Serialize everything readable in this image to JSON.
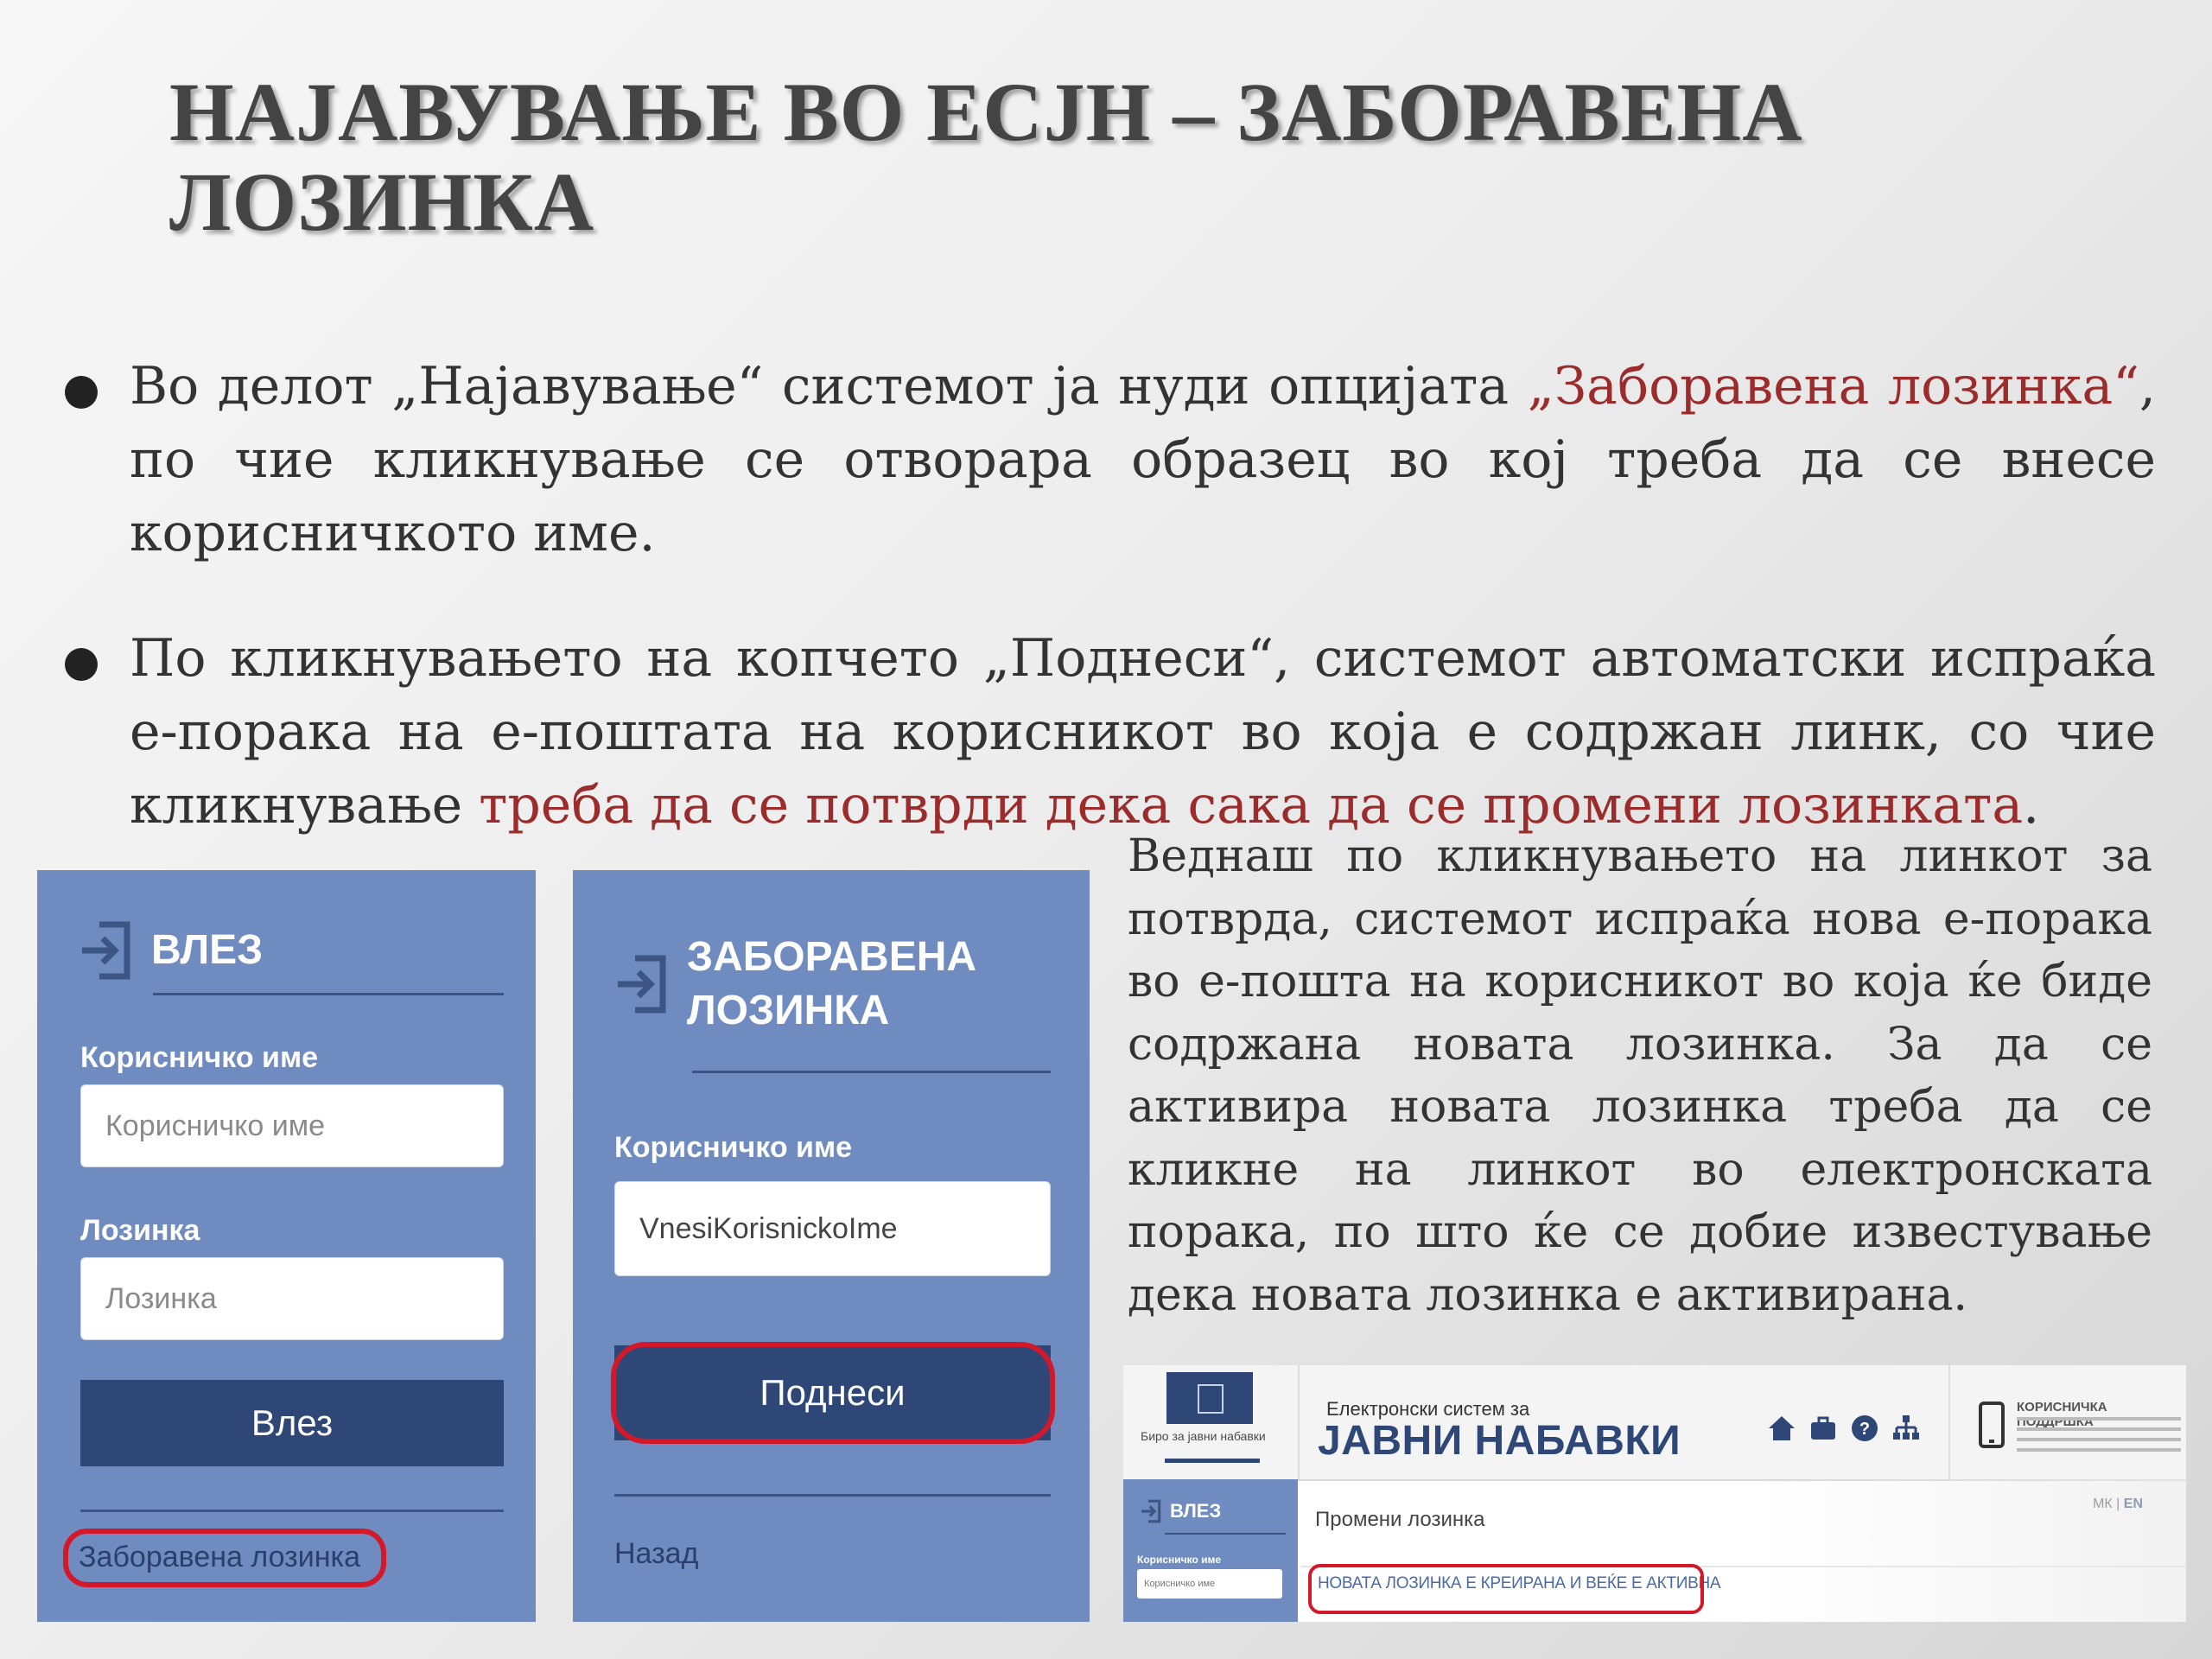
{
  "slide": {
    "title": "НАЈАВУВАЊЕ ВО ЕСЈН – ЗАБОРАВЕНА ЛОЗИНКА",
    "bullets": [
      {
        "part1": "Во делот „Најавување“ системот ја нуди опцијата ",
        "highlight": "„Заборавена лозинка“",
        "part2": ", по чие кликнување се отворара образец во кој треба да се внесе корисничкото име."
      },
      {
        "part1": "По кликнувањето на копчето „Поднеси“, системот автоматски испраќа е-порака на е-поштата на корисникот во која е содржан линк, со чие кликнување ",
        "highlight": "треба да се потврди дека сака да се промени лозинката",
        "part2": "."
      }
    ],
    "side_text": "Веднаш по кликнувањето на линкот за потврда, системот испраќа нова е-порака во е-пошта на корисникот во која ќе биде содржана новата лозинка. За да се активира новата лозинка треба да се кликне на линкот во електронската порака, по што ќе се добие известување дека новата лозинка е активирана.",
    "highlight_color": "#9c2b2b"
  },
  "login_panel": {
    "title": "ВЛЕЗ",
    "username_label": "Корисничко име",
    "username_placeholder": "Корисничко име",
    "password_label": "Лозинка",
    "password_placeholder": "Лозинка",
    "submit_label": "Влез",
    "forgot_link": "Заборавена лозинка"
  },
  "forgot_panel": {
    "title_line1": "ЗАБОРАВЕНА",
    "title_line2": "ЛОЗИНКА",
    "username_label": "Корисничко име",
    "username_value": "VnesiKorisnickoIme",
    "submit_label": "Поднеси",
    "back_link": "Назад"
  },
  "portal": {
    "subtitle": "Електронски систем за",
    "title": "ЈАВНИ НАБАВКИ",
    "logo_caption": "Биро за јавни набавки",
    "page_label": "Промени лозинка",
    "lang_mk": "МК",
    "lang_en": "EN",
    "login_title": "ВЛЕЗ",
    "login_username_label": "Корисничко име",
    "success_message": "НОВАТА ЛОЗИНКА Е КРЕИРАНА И ВЕЌЕ Е АКТИВНА",
    "support_label": "КОРИСНИЧКА ПОДДРШКА"
  },
  "colors": {
    "panel_bg": "#6f8bbf",
    "button_bg": "#2f4777",
    "highlight_ring": "#d3182a"
  }
}
